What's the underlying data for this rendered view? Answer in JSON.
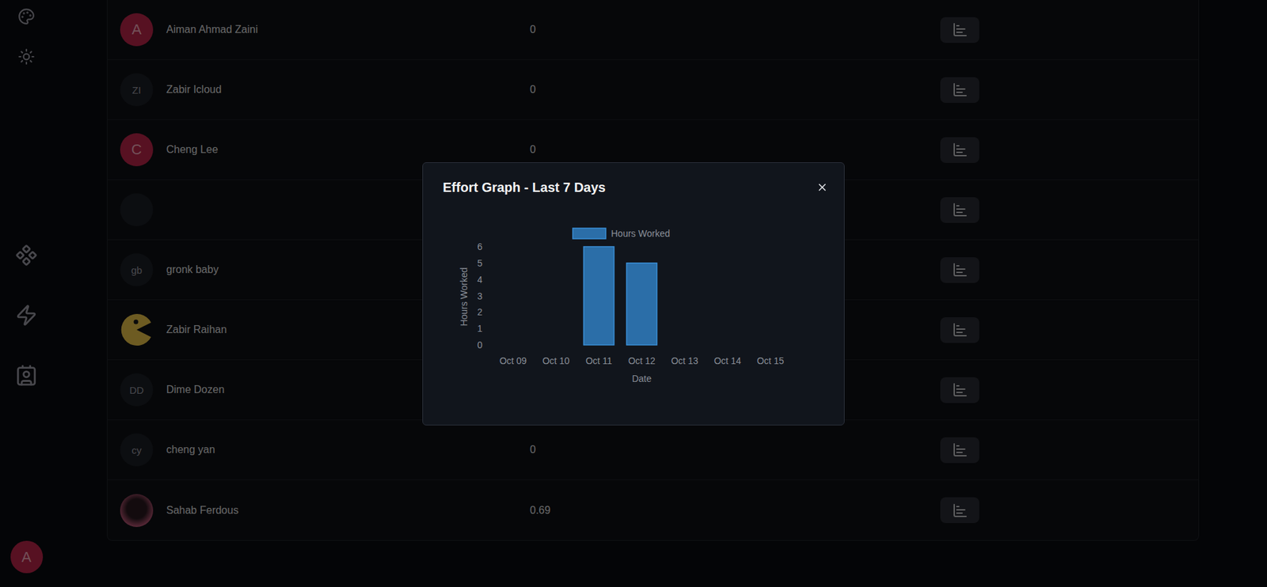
{
  "sidebar": {
    "user_initial": "A"
  },
  "table": {
    "rows": [
      {
        "name": "Aiman Ahmad Zaini",
        "avatar": {
          "kind": "letter",
          "text": "A",
          "color": "#c0264d"
        },
        "effort": "0"
      },
      {
        "name": "Zabir Icloud",
        "avatar": {
          "kind": "initials",
          "text": "ZI"
        },
        "effort": "0"
      },
      {
        "name": "Cheng Lee",
        "avatar": {
          "kind": "letter",
          "text": "C",
          "color": "#c0264d"
        },
        "effort": "0"
      },
      {
        "name": "",
        "avatar": {
          "kind": "empty",
          "text": ""
        }
      },
      {
        "name": "gronk baby",
        "avatar": {
          "kind": "initials",
          "text": "gb"
        }
      },
      {
        "name": "Zabir Raihan",
        "avatar": {
          "kind": "pacman",
          "text": ""
        }
      },
      {
        "name": "Dime Dozen",
        "avatar": {
          "kind": "initials",
          "text": "DD"
        }
      },
      {
        "name": "cheng yan",
        "avatar": {
          "kind": "initials",
          "text": "cy"
        },
        "effort": "0"
      },
      {
        "name": "Sahab Ferdous",
        "avatar": {
          "kind": "photo",
          "text": ""
        },
        "effort": "0.69"
      }
    ]
  },
  "modal": {
    "title": "Effort Graph - Last 7 Days",
    "chart": {
      "y_axis_title": "Hours Worked",
      "x_axis_title": "Date",
      "y_ticks": [
        "0",
        "1",
        "2",
        "3",
        "4",
        "5",
        "6"
      ],
      "categories": [
        "Oct 09",
        "Oct 10",
        "Oct 11",
        "Oct 12",
        "Oct 13",
        "Oct 14",
        "Oct 15"
      ],
      "series": [
        {
          "name": "Hours Worked",
          "values": [
            0,
            0,
            6,
            5,
            0,
            0,
            0
          ]
        }
      ]
    }
  }
}
